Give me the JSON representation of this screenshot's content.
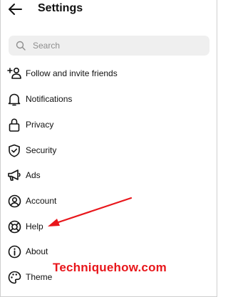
{
  "header": {
    "title": "Settings",
    "back_icon": "arrow-left-icon"
  },
  "search": {
    "placeholder": "Search",
    "icon": "search-icon"
  },
  "menu": {
    "items": [
      {
        "label": "Follow and invite friends",
        "icon": "add-person-icon"
      },
      {
        "label": "Notifications",
        "icon": "bell-icon"
      },
      {
        "label": "Privacy",
        "icon": "lock-icon"
      },
      {
        "label": "Security",
        "icon": "shield-check-icon"
      },
      {
        "label": "Ads",
        "icon": "megaphone-icon"
      },
      {
        "label": "Account",
        "icon": "account-circle-icon"
      },
      {
        "label": "Help",
        "icon": "lifebuoy-icon"
      },
      {
        "label": "About",
        "icon": "info-icon"
      },
      {
        "label": "Theme",
        "icon": "palette-icon"
      }
    ]
  },
  "annotation": {
    "watermark": "Techniquehow.com",
    "arrow_color": "#e8161b"
  }
}
